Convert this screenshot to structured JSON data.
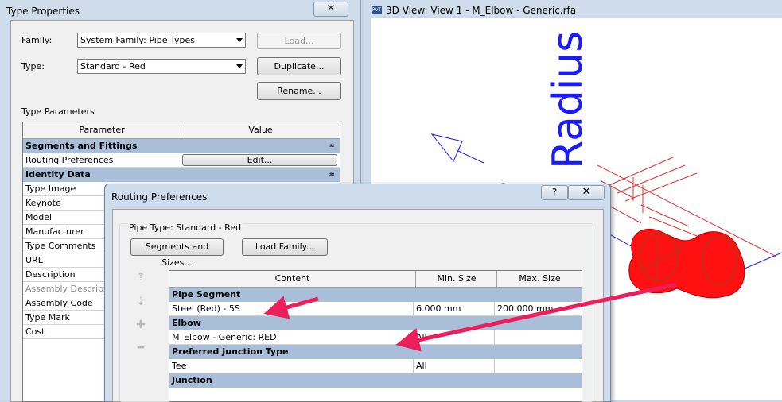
{
  "type_properties": {
    "title": "Type Properties",
    "close_glyph": "✕",
    "family_label": "Family:",
    "family_value": "System Family: Pipe Types",
    "type_label": "Type:",
    "type_value": "Standard - Red",
    "load_label": "Load...",
    "duplicate_label": "Duplicate...",
    "rename_label": "Rename...",
    "type_parameters_label": "Type Parameters",
    "col_parameter": "Parameter",
    "col_value": "Value",
    "group_segments": "Segments and Fittings",
    "routing_preferences": "Routing Preferences",
    "edit_label": "Edit...",
    "group_identity": "Identity Data",
    "collapse_glyph": "≈",
    "params": [
      "Type Image",
      "Keynote",
      "Model",
      "Manufacturer",
      "Type Comments",
      "URL",
      "Description",
      "Assembly Description",
      "Assembly Code",
      "Type Mark",
      "Cost"
    ]
  },
  "view3d": {
    "title": "3D View: View 1 - M_Elbow - Generic.rfa",
    "icon_text": "RVT",
    "radius_text": "Radius",
    "partial_text": "s"
  },
  "routing": {
    "title": "Routing Preferences",
    "help_glyph": "?",
    "close_glyph": "✕",
    "pipe_type_label": "Pipe Type: Standard - Red",
    "segments_button": "Segments and Sizes...",
    "load_family_button": "Load Family...",
    "col_content": "Content",
    "col_min": "Min. Size",
    "col_max": "Max. Size",
    "groups": [
      {
        "name": "Pipe Segment",
        "rows": [
          {
            "content": "Steel (Red) - 5S",
            "min": "6.000 mm",
            "max": "200.000 mm"
          }
        ]
      },
      {
        "name": "Elbow",
        "rows": [
          {
            "content": "M_Elbow - Generic: RED",
            "min": "All",
            "max": ""
          }
        ]
      },
      {
        "name": "Preferred Junction Type",
        "rows": [
          {
            "content": "Tee",
            "min": "All",
            "max": ""
          }
        ]
      },
      {
        "name": "Junction",
        "rows": []
      }
    ]
  },
  "colors": {
    "annotation_arrow": "#ec1f5b",
    "elbow_fill": "#ff1111",
    "dimension_text": "#1a1aff"
  }
}
